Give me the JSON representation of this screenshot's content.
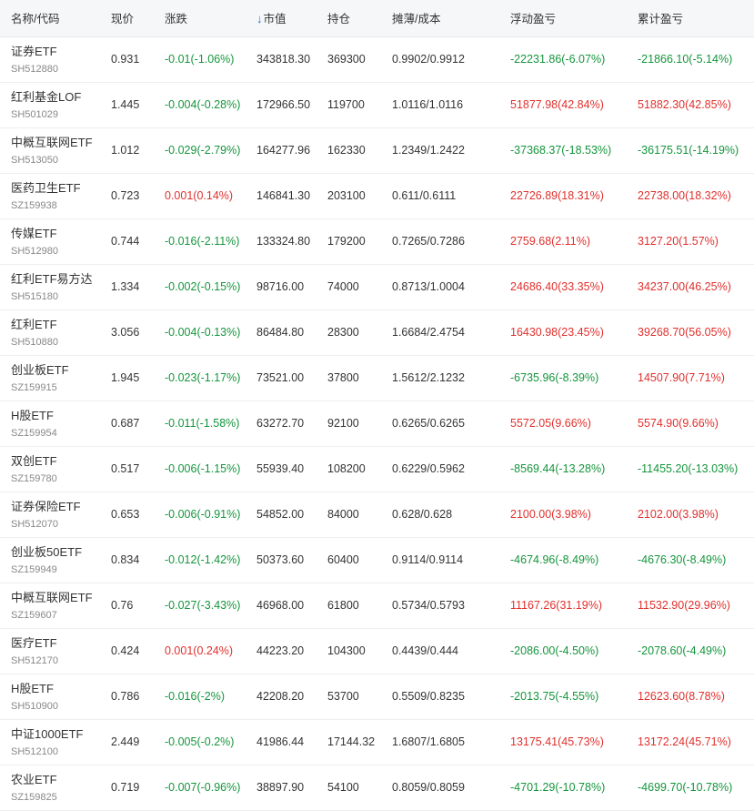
{
  "colors": {
    "up": "#e0302d",
    "down": "#14953c",
    "sort_arrow": "#1f78d1"
  },
  "headers": {
    "name_code": "名称/代码",
    "price": "现价",
    "change": "涨跌",
    "market_value": "市值",
    "position": "持仓",
    "cost": "摊薄/成本",
    "float_pnl": "浮动盈亏",
    "cum_pnl": "累计盈亏",
    "sort_icon": "arrow-down-icon"
  },
  "rows": [
    {
      "name": "证券ETF",
      "code": "SH512880",
      "price": "0.931",
      "change": "-0.01(-1.06%)",
      "change_dir": "down",
      "market_value": "343818.30",
      "position": "369300",
      "cost": "0.9902/0.9912",
      "float_pnl": "-22231.86(-6.07%)",
      "float_dir": "down",
      "cum_pnl": "-21866.10(-5.14%)",
      "cum_dir": "down"
    },
    {
      "name": "红利基金LOF",
      "code": "SH501029",
      "price": "1.445",
      "change": "-0.004(-0.28%)",
      "change_dir": "down",
      "market_value": "172966.50",
      "position": "119700",
      "cost": "1.0116/1.0116",
      "float_pnl": "51877.98(42.84%)",
      "float_dir": "up",
      "cum_pnl": "51882.30(42.85%)",
      "cum_dir": "up"
    },
    {
      "name": "中概互联网ETF",
      "code": "SH513050",
      "price": "1.012",
      "change": "-0.029(-2.79%)",
      "change_dir": "down",
      "market_value": "164277.96",
      "position": "162330",
      "cost": "1.2349/1.2422",
      "float_pnl": "-37368.37(-18.53%)",
      "float_dir": "down",
      "cum_pnl": "-36175.51(-14.19%)",
      "cum_dir": "down"
    },
    {
      "name": "医药卫生ETF",
      "code": "SZ159938",
      "price": "0.723",
      "change": "0.001(0.14%)",
      "change_dir": "up",
      "market_value": "146841.30",
      "position": "203100",
      "cost": "0.611/0.6111",
      "float_pnl": "22726.89(18.31%)",
      "float_dir": "up",
      "cum_pnl": "22738.00(18.32%)",
      "cum_dir": "up"
    },
    {
      "name": "传媒ETF",
      "code": "SH512980",
      "price": "0.744",
      "change": "-0.016(-2.11%)",
      "change_dir": "down",
      "market_value": "133324.80",
      "position": "179200",
      "cost": "0.7265/0.7286",
      "float_pnl": "2759.68(2.11%)",
      "float_dir": "up",
      "cum_pnl": "3127.20(1.57%)",
      "cum_dir": "up"
    },
    {
      "name": "红利ETF易方达",
      "code": "SH515180",
      "price": "1.334",
      "change": "-0.002(-0.15%)",
      "change_dir": "down",
      "market_value": "98716.00",
      "position": "74000",
      "cost": "0.8713/1.0004",
      "float_pnl": "24686.40(33.35%)",
      "float_dir": "up",
      "cum_pnl": "34237.00(46.25%)",
      "cum_dir": "up"
    },
    {
      "name": "红利ETF",
      "code": "SH510880",
      "price": "3.056",
      "change": "-0.004(-0.13%)",
      "change_dir": "down",
      "market_value": "86484.80",
      "position": "28300",
      "cost": "1.6684/2.4754",
      "float_pnl": "16430.98(23.45%)",
      "float_dir": "up",
      "cum_pnl": "39268.70(56.05%)",
      "cum_dir": "up"
    },
    {
      "name": "创业板ETF",
      "code": "SZ159915",
      "price": "1.945",
      "change": "-0.023(-1.17%)",
      "change_dir": "down",
      "market_value": "73521.00",
      "position": "37800",
      "cost": "1.5612/2.1232",
      "float_pnl": "-6735.96(-8.39%)",
      "float_dir": "down",
      "cum_pnl": "14507.90(7.71%)",
      "cum_dir": "up"
    },
    {
      "name": "H股ETF",
      "code": "SZ159954",
      "price": "0.687",
      "change": "-0.011(-1.58%)",
      "change_dir": "down",
      "market_value": "63272.70",
      "position": "92100",
      "cost": "0.6265/0.6265",
      "float_pnl": "5572.05(9.66%)",
      "float_dir": "up",
      "cum_pnl": "5574.90(9.66%)",
      "cum_dir": "up"
    },
    {
      "name": "双创ETF",
      "code": "SZ159780",
      "price": "0.517",
      "change": "-0.006(-1.15%)",
      "change_dir": "down",
      "market_value": "55939.40",
      "position": "108200",
      "cost": "0.6229/0.5962",
      "float_pnl": "-8569.44(-13.28%)",
      "float_dir": "down",
      "cum_pnl": "-11455.20(-13.03%)",
      "cum_dir": "down"
    },
    {
      "name": "证券保险ETF",
      "code": "SH512070",
      "price": "0.653",
      "change": "-0.006(-0.91%)",
      "change_dir": "down",
      "market_value": "54852.00",
      "position": "84000",
      "cost": "0.628/0.628",
      "float_pnl": "2100.00(3.98%)",
      "float_dir": "up",
      "cum_pnl": "2102.00(3.98%)",
      "cum_dir": "up"
    },
    {
      "name": "创业板50ETF",
      "code": "SZ159949",
      "price": "0.834",
      "change": "-0.012(-1.42%)",
      "change_dir": "down",
      "market_value": "50373.60",
      "position": "60400",
      "cost": "0.9114/0.9114",
      "float_pnl": "-4674.96(-8.49%)",
      "float_dir": "down",
      "cum_pnl": "-4676.30(-8.49%)",
      "cum_dir": "down"
    },
    {
      "name": "中概互联网ETF",
      "code": "SZ159607",
      "price": "0.76",
      "change": "-0.027(-3.43%)",
      "change_dir": "down",
      "market_value": "46968.00",
      "position": "61800",
      "cost": "0.5734/0.5793",
      "float_pnl": "11167.26(31.19%)",
      "float_dir": "up",
      "cum_pnl": "11532.90(29.96%)",
      "cum_dir": "up"
    },
    {
      "name": "医疗ETF",
      "code": "SH512170",
      "price": "0.424",
      "change": "0.001(0.24%)",
      "change_dir": "up",
      "market_value": "44223.20",
      "position": "104300",
      "cost": "0.4439/0.444",
      "float_pnl": "-2086.00(-4.50%)",
      "float_dir": "down",
      "cum_pnl": "-2078.60(-4.49%)",
      "cum_dir": "down"
    },
    {
      "name": "H股ETF",
      "code": "SH510900",
      "price": "0.786",
      "change": "-0.016(-2%)",
      "change_dir": "down",
      "market_value": "42208.20",
      "position": "53700",
      "cost": "0.5509/0.8235",
      "float_pnl": "-2013.75(-4.55%)",
      "float_dir": "down",
      "cum_pnl": "12623.60(8.78%)",
      "cum_dir": "up"
    },
    {
      "name": "中证1000ETF",
      "code": "SH512100",
      "price": "2.449",
      "change": "-0.005(-0.2%)",
      "change_dir": "down",
      "market_value": "41986.44",
      "position": "17144.32",
      "cost": "1.6807/1.6805",
      "float_pnl": "13175.41(45.73%)",
      "float_dir": "up",
      "cum_pnl": "13172.24(45.71%)",
      "cum_dir": "up"
    },
    {
      "name": "农业ETF",
      "code": "SZ159825",
      "price": "0.719",
      "change": "-0.007(-0.96%)",
      "change_dir": "down",
      "market_value": "38897.90",
      "position": "54100",
      "cost": "0.8059/0.8059",
      "float_pnl": "-4701.29(-10.78%)",
      "float_dir": "down",
      "cum_pnl": "-4699.70(-10.78%)",
      "cum_dir": "down"
    }
  ]
}
